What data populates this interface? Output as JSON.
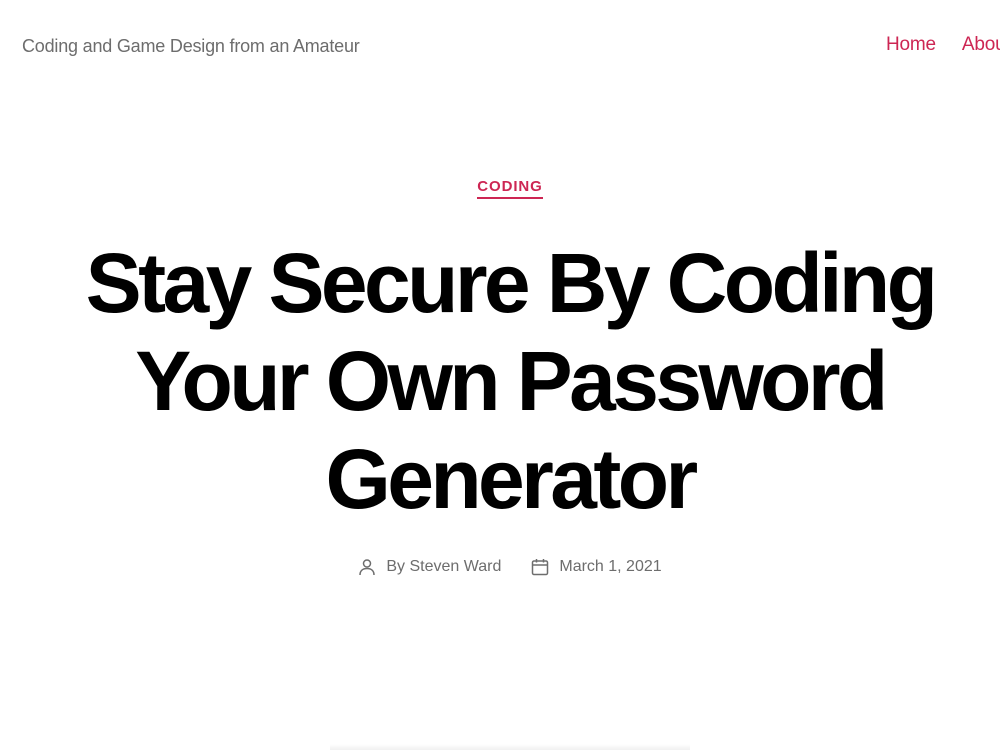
{
  "header": {
    "tagline": "Coding and Game Design from an Amateur",
    "nav": [
      {
        "label": "Home"
      },
      {
        "label": "About"
      }
    ]
  },
  "post": {
    "category": "CODING",
    "title_lines": [
      "Stay Secure By Coding",
      "Your Own Password",
      "Generator"
    ],
    "meta": {
      "author": "By Steven Ward",
      "author_icon": "user-icon",
      "date": "March 1, 2021",
      "date_icon": "calendar-icon"
    }
  },
  "colors": {
    "accent": "#cd2653",
    "meta_text": "#6d6d6d",
    "title_text": "#000000"
  }
}
